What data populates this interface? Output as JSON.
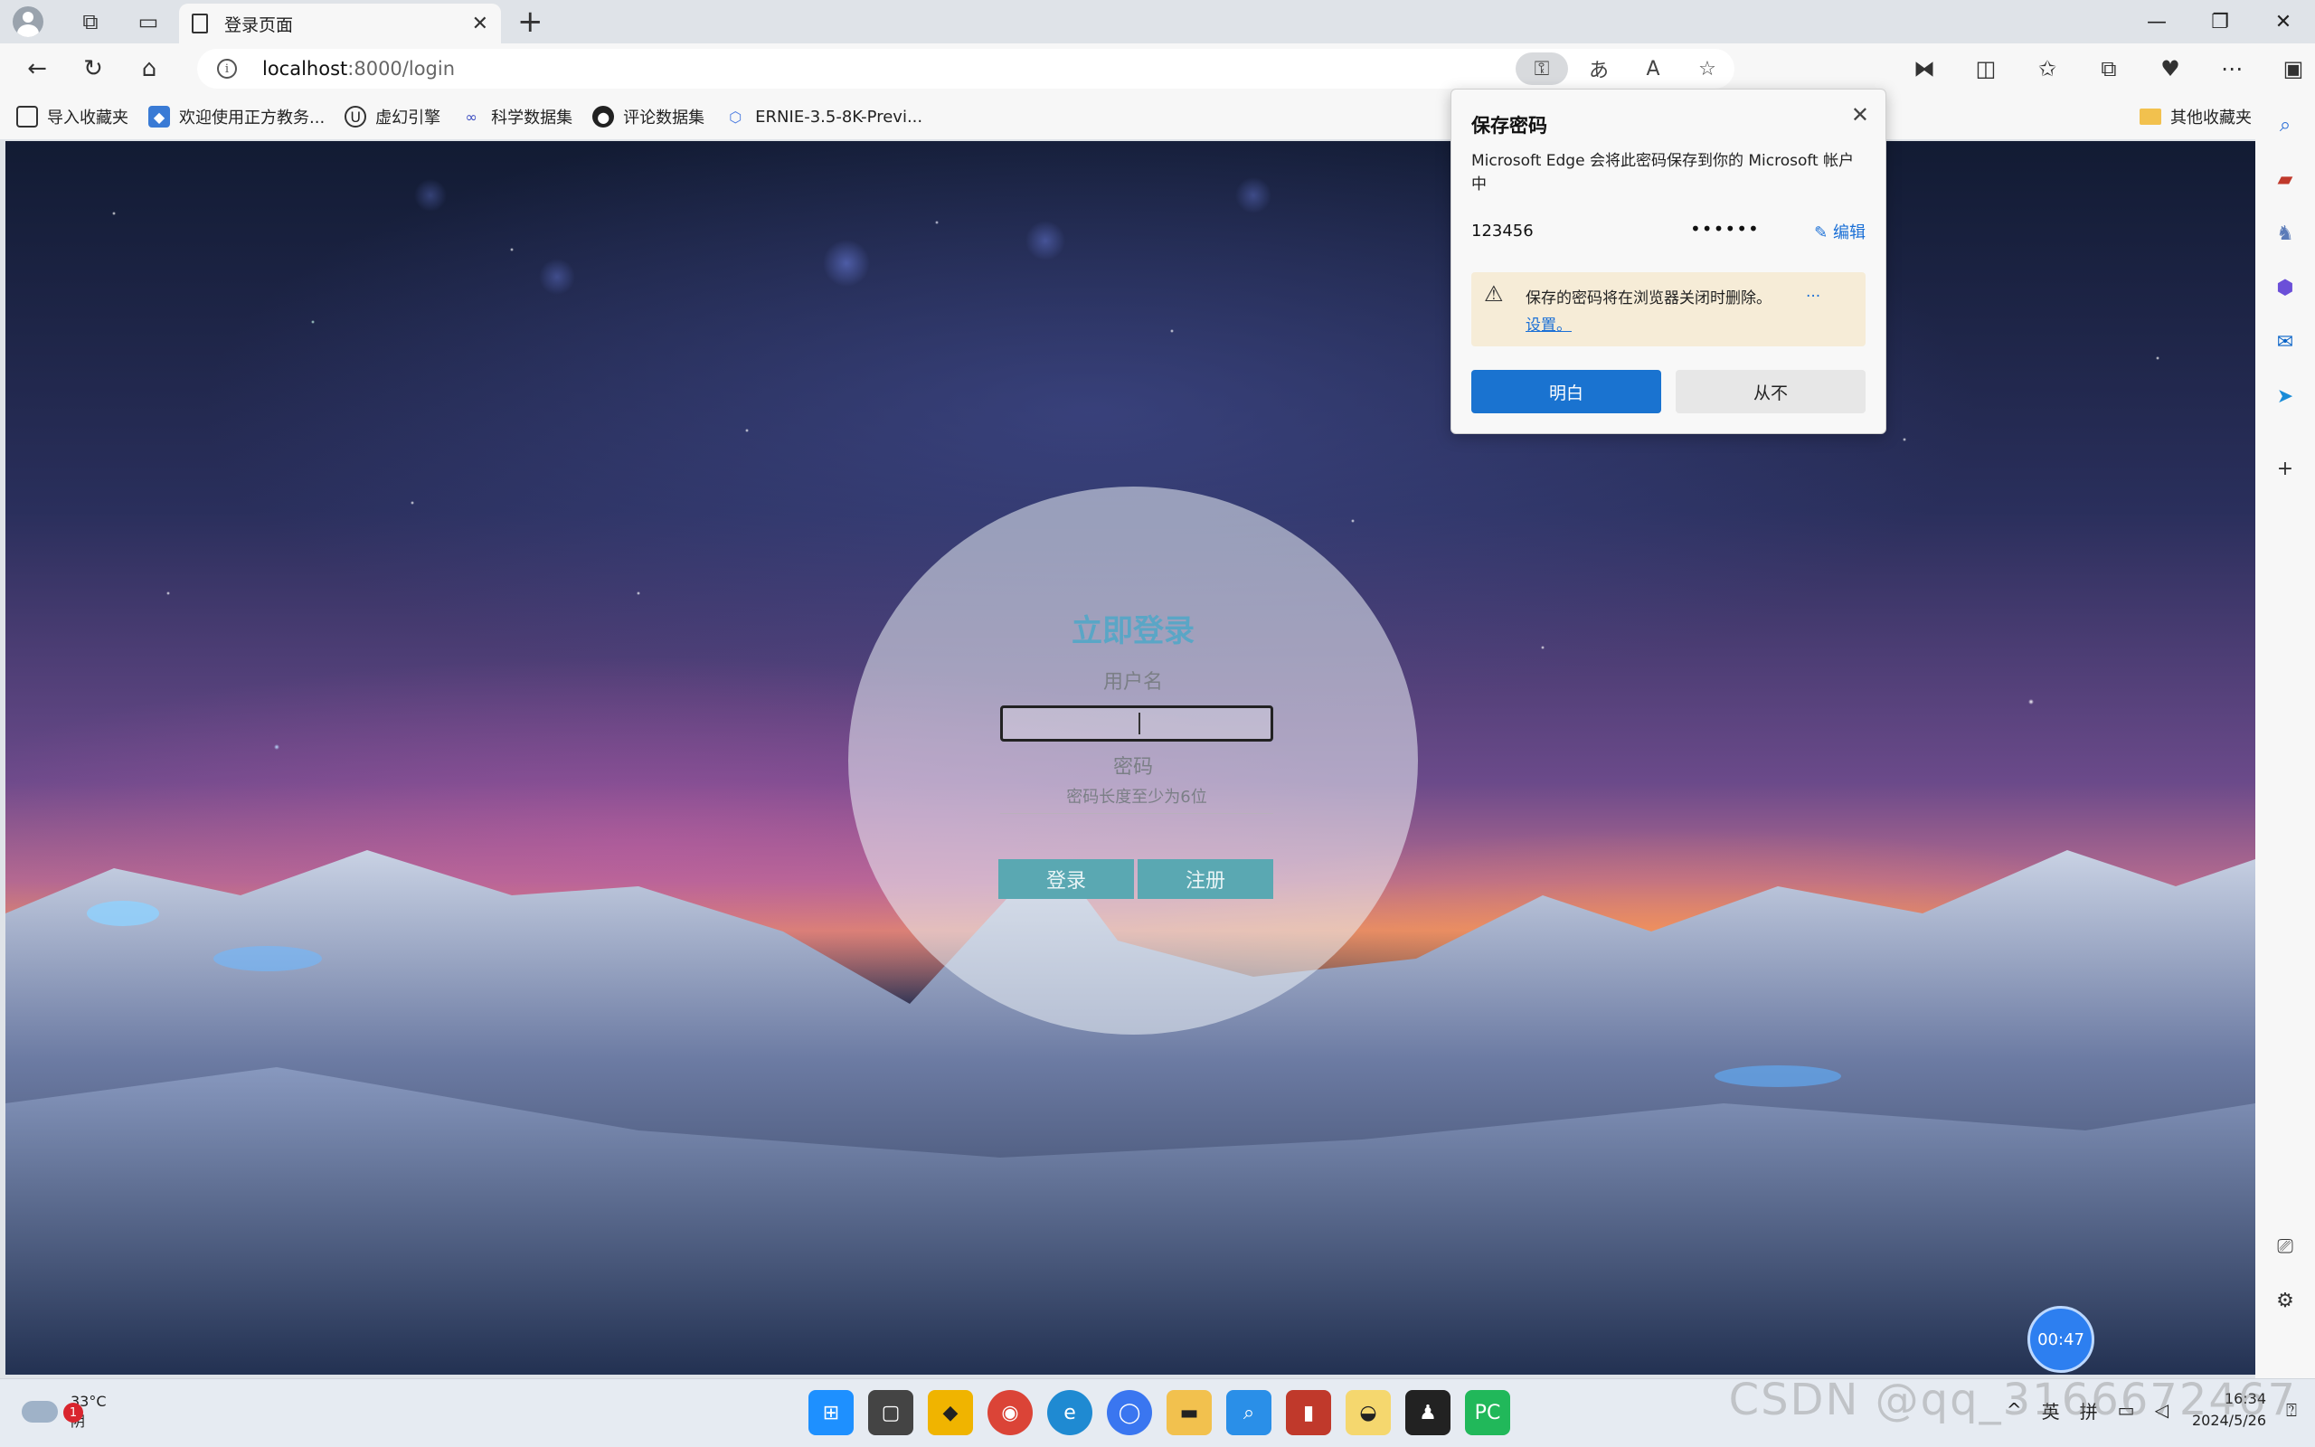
{
  "tab": {
    "title": "登录页面",
    "close": "✕"
  },
  "window": {
    "minimize": "—",
    "maximize": "❐",
    "close": "✕"
  },
  "address": {
    "host": "localhost",
    "path": ":8000/login"
  },
  "favorites": [
    {
      "label": "导入收藏夹",
      "icon": "import-icon"
    },
    {
      "label": "欢迎使用正方教务...",
      "icon": "zf-icon"
    },
    {
      "label": "虚幻引擎",
      "icon": "unreal-icon"
    },
    {
      "label": "科学数据集",
      "icon": "dataset-icon"
    },
    {
      "label": "评论数据集",
      "icon": "github-icon"
    },
    {
      "label": "ERNIE-3.5-8K-Previ...",
      "icon": "ernie-icon"
    }
  ],
  "favorites_other": "其他收藏夹",
  "login": {
    "title": "立即登录",
    "username_label": "用户名",
    "password_label": "密码",
    "password_placeholder": "密码长度至少为6位",
    "login_button": "登录",
    "register_button": "注册"
  },
  "timer": "00:47",
  "save_password": {
    "title": "保存密码",
    "description": "Microsoft Edge 会将此密码保存到你的 Microsoft 帐户中",
    "username": "123456",
    "password_mask": "••••••",
    "edit": "编辑",
    "warning": "保存的密码将在浏览器关闭时删除。",
    "warning_more": "...",
    "settings_link": "设置。",
    "ok_button": "明白",
    "never_button": "从不"
  },
  "taskbar": {
    "weather_temp": "33°C",
    "weather_cond": "阴",
    "weather_badge": "1",
    "tray_ime1": "英",
    "tray_ime2": "拼",
    "time": "16:34",
    "date": "2024/5/26"
  },
  "watermark": "CSDN @qq_3166672467"
}
